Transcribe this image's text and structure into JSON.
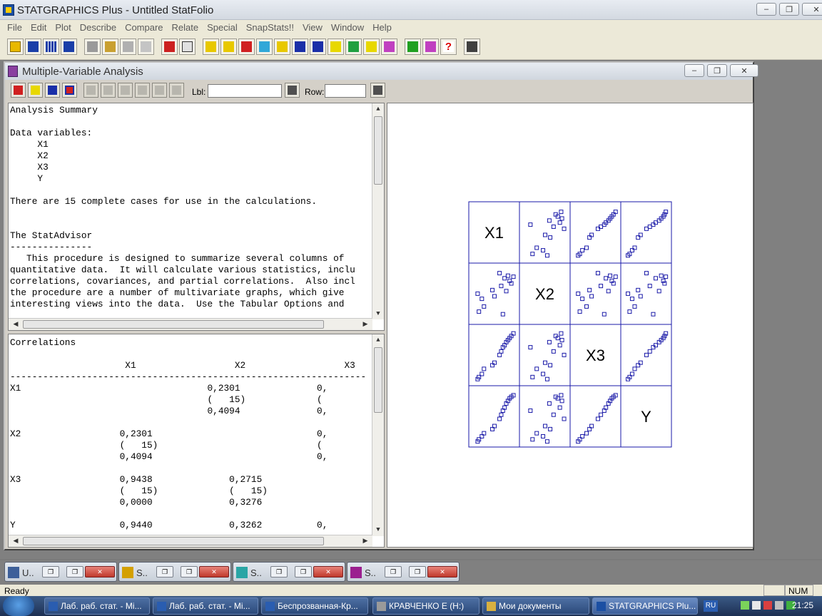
{
  "app": {
    "title": "STATGRAPHICS Plus - Untitled StatFolio",
    "menu": [
      "File",
      "Edit",
      "Plot",
      "Describe",
      "Compare",
      "Relate",
      "Special",
      "SnapStats!!",
      "View",
      "Window",
      "Help"
    ],
    "toolbar_icons": [
      "open-folder-icon",
      "save-icon",
      "data-grid-icon",
      "numeric-data-icon",
      "cut-icon",
      "copy-icon",
      "paste-icon",
      "undo-icon",
      "print-icon",
      "print-preview-icon",
      "scatter-icon",
      "boxplot-icon",
      "histogram-icon",
      "cross-icon",
      "sparkline-icon",
      "wave-icon",
      "normal-curve-icon",
      "line-chart-icon",
      "globe-icon",
      "step-chart-icon",
      "glm-icon",
      "statadvisor-icon",
      "statwizard-icon",
      "help-icon",
      "calculator-icon"
    ]
  },
  "child": {
    "title": "Multiple-Variable Analysis",
    "lbl_label": "Lbl:",
    "lbl_value": "",
    "row_label": "Row:",
    "row_value": ""
  },
  "summary": {
    "lines": [
      "Analysis Summary",
      "",
      "Data variables:",
      "     X1",
      "     X2",
      "     X3",
      "     Y",
      "",
      "There are 15 complete cases for use in the calculations.",
      "",
      "",
      "The StatAdvisor",
      "---------------",
      "   This procedure is designed to summarize several columns of",
      "quantitative data.  It will calculate various statistics, inclu",
      "correlations, covariances, and partial correlations.  Also incl",
      "the procedure are a number of multivariate graphs, which give",
      "interesting views into the data.  Use the Tabular Options and"
    ]
  },
  "correlations": {
    "lines": [
      "Correlations",
      "",
      "                     X1                  X2                  X3",
      "-----------------------------------------------------------------",
      "X1                                  0,2301              0,",
      "                                    (   15)             (",
      "                                    0,4094              0,",
      "",
      "X2                  0,2301                              0,",
      "                    (   15)                             (",
      "                    0,4094                              0,",
      "",
      "X3                  0,9438              0,2715",
      "                    (   15)             (   15)",
      "                    0,0000              0,3276",
      "",
      "Y                   0,9440              0,3262          0,"
    ]
  },
  "chart_data": {
    "type": "scatter",
    "variables": [
      "X1",
      "X2",
      "X3",
      "Y"
    ],
    "marker": "square",
    "color": "#1a1aa8",
    "series": [
      {
        "name": "X1",
        "values": [
          0.1,
          0.13,
          0.2,
          0.25,
          0.45,
          0.5,
          0.62,
          0.66,
          0.7,
          0.74,
          0.78,
          0.82,
          0.86,
          0.9,
          0.95
        ]
      },
      {
        "name": "X2",
        "values": [
          0.55,
          0.2,
          0.45,
          0.3,
          0.62,
          0.5,
          0.95,
          0.7,
          0.15,
          0.85,
          0.6,
          0.9,
          0.8,
          0.75,
          0.88
        ]
      },
      {
        "name": "X3",
        "values": [
          0.08,
          0.12,
          0.18,
          0.28,
          0.35,
          0.4,
          0.55,
          0.62,
          0.7,
          0.74,
          0.8,
          0.84,
          0.88,
          0.92,
          0.97
        ]
      },
      {
        "name": "Y",
        "values": [
          0.06,
          0.1,
          0.16,
          0.22,
          0.3,
          0.36,
          0.5,
          0.58,
          0.66,
          0.72,
          0.8,
          0.85,
          0.9,
          0.93,
          0.96
        ]
      }
    ]
  },
  "minimized": [
    {
      "title": "U..",
      "icon_color": "#3d5f99"
    },
    {
      "title": "S..",
      "icon_color": "#d4a000"
    },
    {
      "title": "S..",
      "icon_color": "#2aa5a5"
    },
    {
      "title": "S..",
      "icon_color": "#9b1f8f"
    }
  ],
  "status": {
    "text": "Ready",
    "num": "NUM"
  },
  "taskbar": {
    "tasks": [
      "Лаб. раб. стат. - Mi...",
      "Лаб. раб. стат. - Mi...",
      "Беспрозванная-Кр...",
      "КРАВЧЕНКО Е (H:)",
      "Мои документы",
      "STATGRAPHICS Plu..."
    ],
    "lang": "RU",
    "clock": "21:25"
  }
}
